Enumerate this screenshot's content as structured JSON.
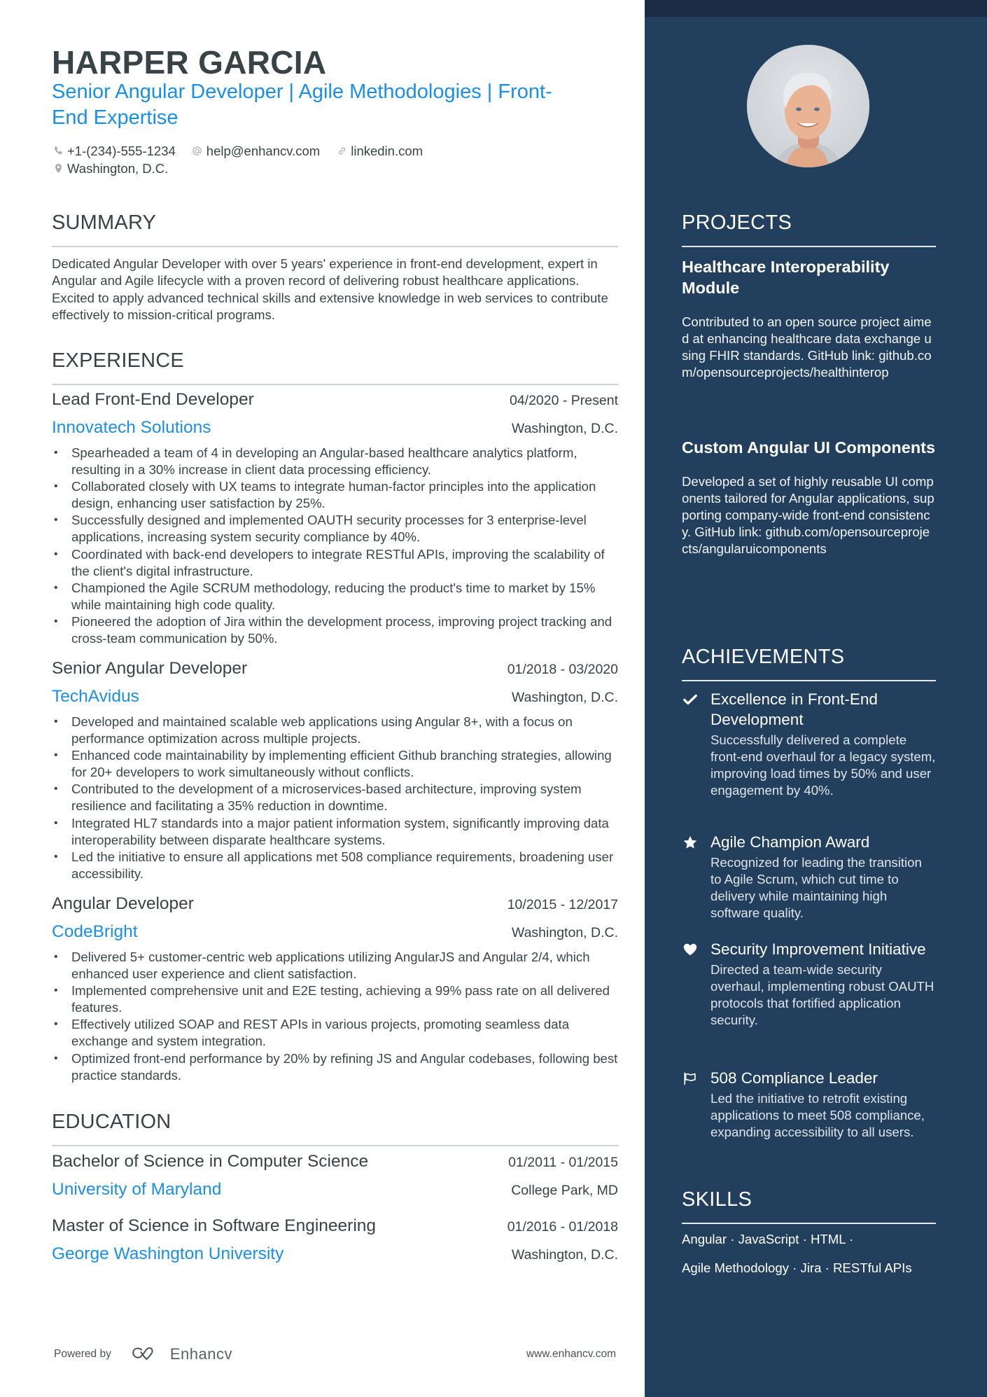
{
  "header": {
    "name": "HARPER GARCIA",
    "title": "Senior Angular Developer | Agile Methodologies | Front-End Expertise",
    "contacts": {
      "phone": "+1-(234)-555-1234",
      "email": "help@enhancv.com",
      "website": "linkedin.com",
      "location": "Washington, D.C."
    }
  },
  "summary": {
    "heading": "SUMMARY",
    "text": "Dedicated Angular Developer with over 5 years' experience in front-end development, expert in Angular and Agile lifecycle with a proven record of delivering robust healthcare applications. Excited to apply advanced technical skills and extensive knowledge in web services to contribute effectively to mission-critical programs."
  },
  "experience": {
    "heading": "EXPERIENCE",
    "jobs": [
      {
        "role": "Lead Front-End Developer",
        "dates": "04/2020 - Present",
        "company": "Innovatech Solutions",
        "location": "Washington, D.C.",
        "bullets": [
          "Spearheaded a team of 4 in developing an Angular-based healthcare analytics platform, resulting in a 30% increase in client data processing efficiency.",
          "Collaborated closely with UX teams to integrate human-factor principles into the application design, enhancing user satisfaction by 25%.",
          "Successfully designed and implemented OAUTH security processes for 3 enterprise-level applications, increasing system security compliance by 40%.",
          "Coordinated with back-end developers to integrate RESTful APIs, improving the scalability of the client's digital infrastructure.",
          "Championed the Agile SCRUM methodology, reducing the product's time to market by 15% while maintaining high code quality.",
          "Pioneered the adoption of Jira within the development process, improving project tracking and cross-team communication by 50%."
        ]
      },
      {
        "role": "Senior Angular Developer",
        "dates": "01/2018 - 03/2020",
        "company": "TechAvidus",
        "location": "Washington, D.C.",
        "bullets": [
          "Developed and maintained scalable web applications using Angular 8+, with a focus on performance optimization across multiple projects.",
          "Enhanced code maintainability by implementing efficient Github branching strategies, allowing for 20+ developers to work simultaneously without conflicts.",
          "Contributed to the development of a microservices-based architecture, improving system resilience and facilitating a 35% reduction in downtime.",
          "Integrated HL7 standards into a major patient information system, significantly improving data interoperability between disparate healthcare systems.",
          "Led the initiative to ensure all applications met 508 compliance requirements, broadening user accessibility."
        ]
      },
      {
        "role": "Angular Developer",
        "dates": "10/2015 - 12/2017",
        "company": "CodeBright",
        "location": "Washington, D.C.",
        "bullets": [
          "Delivered 5+ customer-centric web applications utilizing AngularJS and Angular 2/4, which enhanced user experience and client satisfaction.",
          "Implemented comprehensive unit and E2E testing, achieving a 99% pass rate on all delivered features.",
          "Effectively utilized SOAP and REST APIs in various projects, promoting seamless data exchange and system integration.",
          "Optimized front-end performance by 20% by refining JS and Angular codebases, following best practice standards."
        ]
      }
    ]
  },
  "education": {
    "heading": "EDUCATION",
    "items": [
      {
        "degree": "Bachelor of Science in Computer Science",
        "dates": "01/2011 - 01/2015",
        "school": "University of Maryland",
        "location": "College Park, MD"
      },
      {
        "degree": "Master of Science in Software Engineering",
        "dates": "01/2016 - 01/2018",
        "school": "George Washington University",
        "location": "Washington, D.C."
      }
    ]
  },
  "projects": {
    "heading": "PROJECTS",
    "items": [
      {
        "title": "Healthcare Interoperability Module",
        "description": "Contributed to an open source project aimed at enhancing healthcare data exchange using FHIR standards. GitHub link: github.com/opensourceprojects/healthinterop"
      },
      {
        "title": "Custom Angular UI Components",
        "description": "Developed a set of highly reusable UI components tailored for Angular applications, supporting company-wide front-end consistency. GitHub link: github.com/opensourceprojects/angularuicomponents"
      }
    ]
  },
  "achievements": {
    "heading": "ACHIEVEMENTS",
    "items": [
      {
        "icon": "check-icon",
        "title": "Excellence in Front-End Development",
        "description": "Successfully delivered a complete front-end overhaul for a legacy system, improving load times by 50% and user engagement by 40%."
      },
      {
        "icon": "star-icon",
        "title": "Agile Champion Award",
        "description": "Recognized for leading the transition to Agile Scrum, which cut time to delivery while maintaining high software quality."
      },
      {
        "icon": "heart-icon",
        "title": "Security Improvement Initiative",
        "description": "Directed a team-wide security overhaul, implementing robust OAUTH protocols that fortified application security."
      },
      {
        "icon": "flag-icon",
        "title": "508 Compliance Leader",
        "description": "Led the initiative to retrofit existing applications to meet 508 compliance, expanding accessibility to all users."
      }
    ]
  },
  "skills": {
    "heading": "SKILLS",
    "lines": [
      "Angular · JavaScript · HTML ·",
      "Agile Methodology · Jira · RESTful APIs"
    ]
  },
  "footer": {
    "powered_by": "Powered by",
    "brand": "Enhancv",
    "website": "www.enhancv.com"
  },
  "colors": {
    "accent": "#1a8fe8",
    "sidebar_bg": "#22405e",
    "sidebar_top": "#1b2d45",
    "text": "#384347"
  }
}
